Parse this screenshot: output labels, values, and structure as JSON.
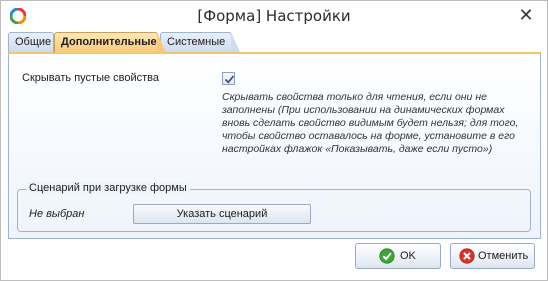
{
  "window": {
    "title": "[Форма] Настройки",
    "app_icon": "ring-logo-icon",
    "close_icon": "close-icon"
  },
  "tabs": [
    {
      "label": "Общие",
      "active": false
    },
    {
      "label": "Дополнительные",
      "active": true
    },
    {
      "label": "Системные",
      "active": false
    }
  ],
  "panel": {
    "hide_empty_label": "Скрывать пустые свойства",
    "hide_empty_checked": true,
    "hint": "Скрывать свойства только для чтения, если они не заполнены (При использовании на динамических формах вновь сделать свойство видимым будет нельзя; для того, чтобы свойство оставалось на форме, установите в его настройках флажок «Показывать, даже если пусто»)",
    "scenario_group": {
      "title": "Сценарий при загрузке формы",
      "value": "Не выбран",
      "button_label": "Указать сценарий"
    }
  },
  "footer": {
    "ok_label": "OK",
    "cancel_label": "Отменить",
    "ok_icon": "check-circle-icon",
    "cancel_icon": "cancel-circle-icon"
  },
  "colors": {
    "active_tab": "#f7c978",
    "accent_border": "#9fb3cc",
    "ok_green": "#3fa535",
    "cancel_red": "#d9342b"
  }
}
